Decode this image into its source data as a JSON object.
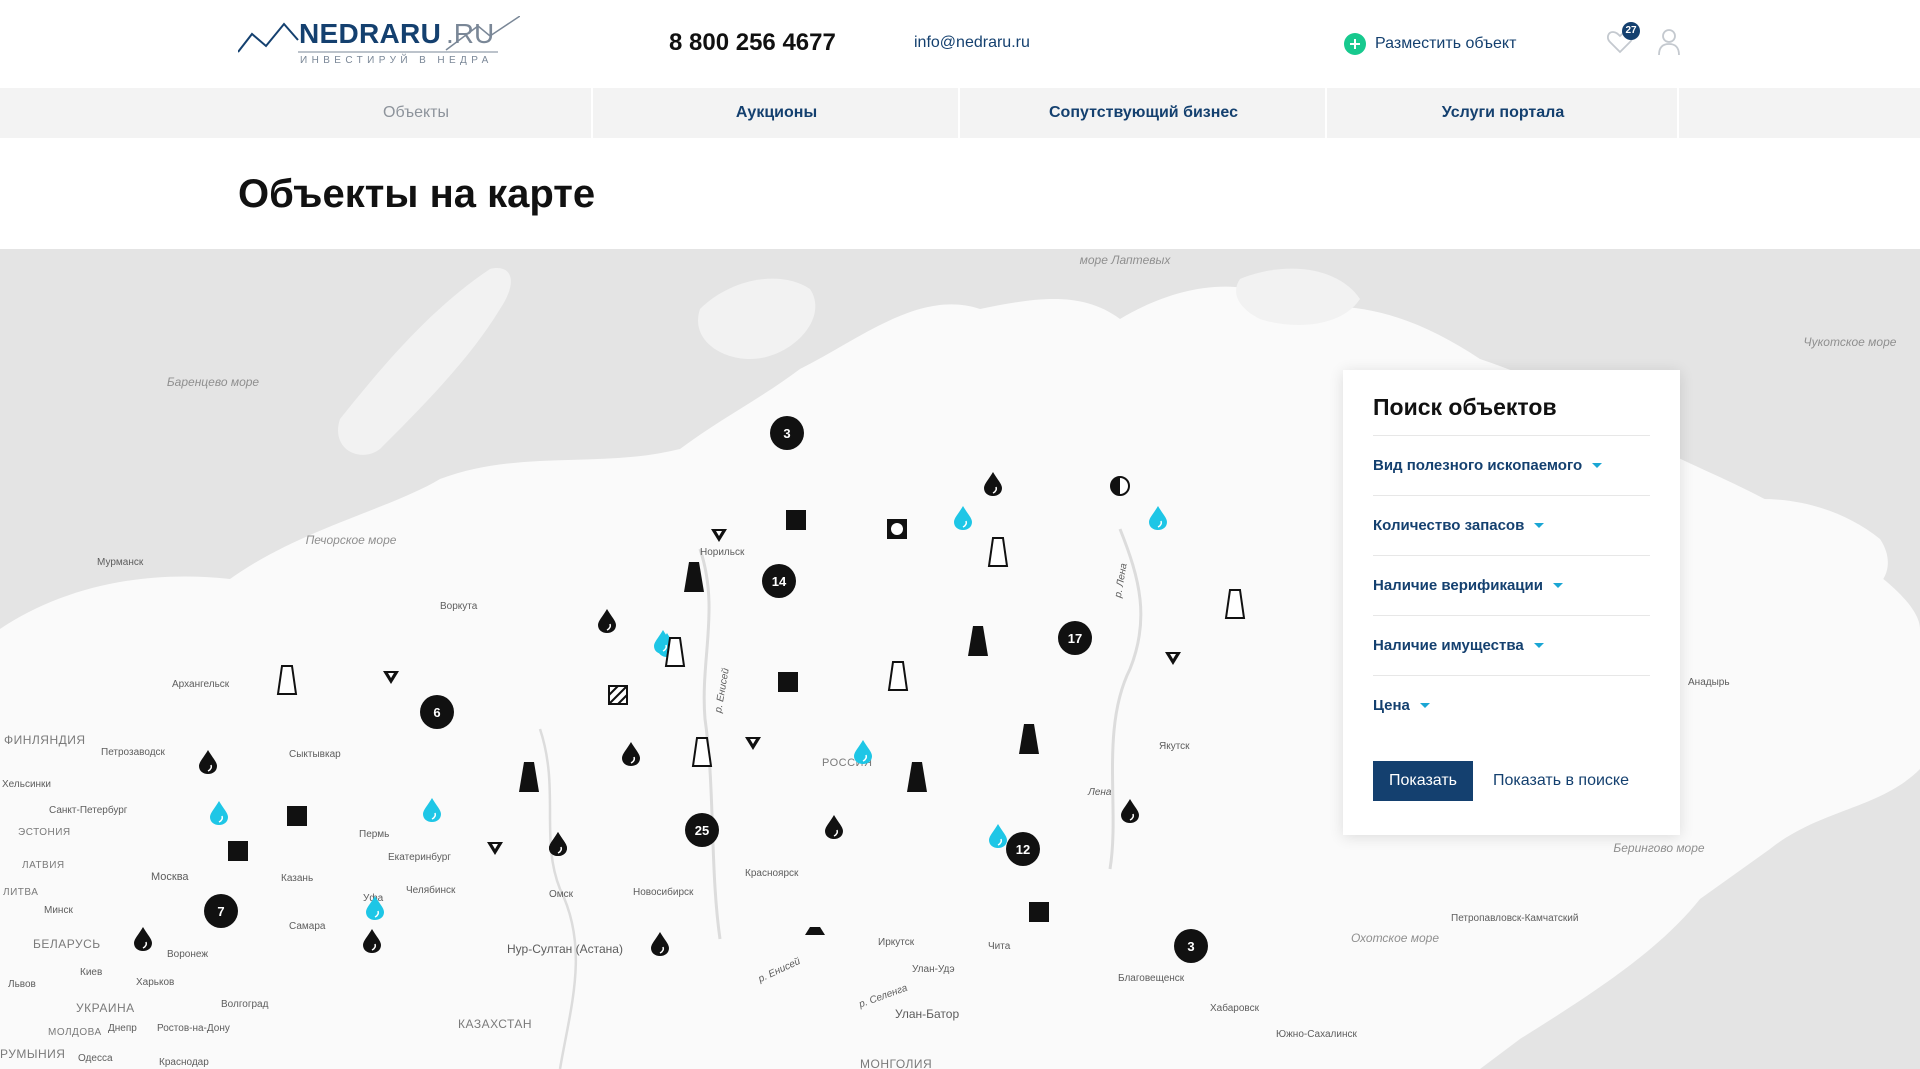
{
  "header": {
    "logo_name": "NEDRARU",
    "logo_tld": ".RU",
    "logo_tagline": "ИНВЕСТИРУЙ В НЕДРА",
    "phone": "8 800 256 4677",
    "email": "info@nedraru.ru",
    "place_object_label": "Разместить объект",
    "favorites_count": "27",
    "accent_color": "#17c98e",
    "brand_color": "#14406f"
  },
  "nav": {
    "items": [
      {
        "label": "Объекты",
        "active": true
      },
      {
        "label": "Аукционы",
        "active": false
      },
      {
        "label": "Сопутствующий бизнес",
        "active": false
      },
      {
        "label": "Услуги портала",
        "active": false
      }
    ]
  },
  "page": {
    "title": "Объекты на карте"
  },
  "map": {
    "seas": [
      "море Лаптевых",
      "Баренцево море",
      "Печорское море",
      "Чукотское море",
      "Берингово море",
      "Охотское море"
    ],
    "countries": [
      "ФИНЛЯНДИЯ",
      "ЭСТОНИЯ",
      "ЛАТВИЯ",
      "ЛИТВА",
      "БЕЛАРУСЬ",
      "УКРАИНА",
      "МОЛДОВА",
      "РУМЫНИЯ",
      "КАЗАХСТАН",
      "МОНГОЛИЯ",
      "РОССИЯ"
    ],
    "cities": [
      "Мурманск",
      "Воркута",
      "Норильск",
      "Архангельск",
      "Петрозаводск",
      "Сыктывкар",
      "Хельсинки",
      "Санкт-Петербург",
      "Пермь",
      "Екатеринбург",
      "Москва",
      "Казань",
      "Минск",
      "Уфа",
      "Челябинск",
      "Омск",
      "Новосибирск",
      "Красноярск",
      "Самара",
      "Воронеж",
      "Киев",
      "Харьков",
      "Нур-Султан (Астана)",
      "Иркутск",
      "Чита",
      "Улан-Удэ",
      "Улан-Батор",
      "Якутск",
      "Благовещенск",
      "Хабаровск",
      "Анадырь",
      "Петропавловск-Камчатский",
      "Южно-Сахалинск",
      "Волгоград",
      "Ростов-на-Дону",
      "Днепр",
      "Львов",
      "Одесса",
      "Краснодар"
    ],
    "rivers": [
      "р. Енисей",
      "р. Лена",
      "Лена",
      "р. Енисей",
      "р. Селенга"
    ],
    "clusters": [
      "3",
      "14",
      "17",
      "6",
      "25",
      "12",
      "7",
      "3"
    ]
  },
  "search_panel": {
    "title": "Поиск объектов",
    "filters": [
      "Вид полезного ископаемого",
      "Количество запасов",
      "Наличие верификации",
      "Наличие имущества",
      "Цена"
    ],
    "show_button": "Показать",
    "show_in_search": "Показать в поиске"
  }
}
